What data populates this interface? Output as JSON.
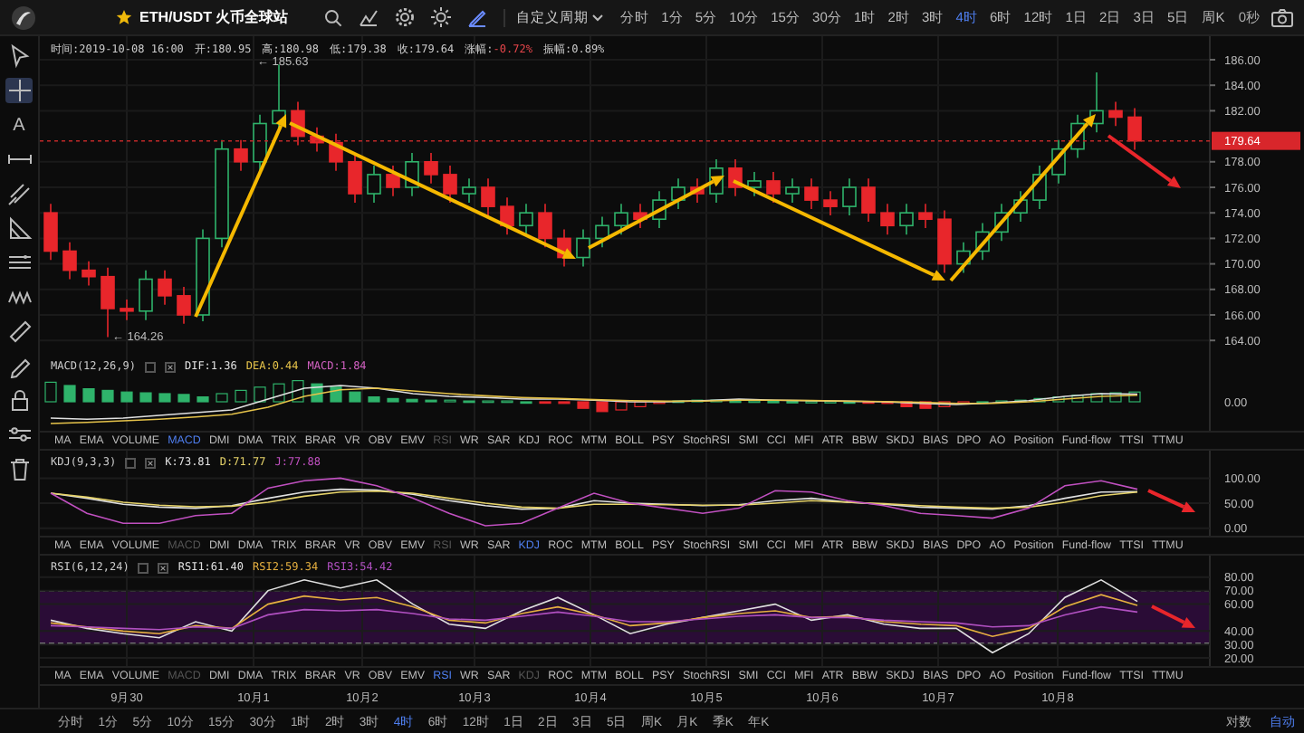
{
  "toolbar": {
    "symbol": "ETH/USDT 火币全球站",
    "custom_period": "自定义周期",
    "countdown": "0秒",
    "periods": [
      {
        "label": "分时",
        "selected": false
      },
      {
        "label": "1分",
        "selected": false
      },
      {
        "label": "5分",
        "selected": false
      },
      {
        "label": "10分",
        "selected": false
      },
      {
        "label": "15分",
        "selected": false
      },
      {
        "label": "30分",
        "selected": false
      },
      {
        "label": "1时",
        "selected": false
      },
      {
        "label": "2时",
        "selected": false
      },
      {
        "label": "3时",
        "selected": false
      },
      {
        "label": "4时",
        "selected": true
      },
      {
        "label": "6时",
        "selected": false
      },
      {
        "label": "12时",
        "selected": false
      },
      {
        "label": "1日",
        "selected": false
      },
      {
        "label": "2日",
        "selected": false
      },
      {
        "label": "3日",
        "selected": false
      },
      {
        "label": "5日",
        "selected": false
      },
      {
        "label": "周K",
        "selected": false
      }
    ]
  },
  "drawing_tools": [
    {
      "selected": false
    },
    {
      "selected": true
    },
    {
      "selected": false,
      "glyph": "A"
    },
    {
      "selected": false
    },
    {
      "selected": false
    },
    {
      "selected": false
    },
    {
      "selected": false
    },
    {
      "selected": false
    },
    {
      "selected": false
    },
    {
      "selected": false
    },
    {
      "selected": false
    },
    {
      "selected": false
    },
    {
      "selected": false
    }
  ],
  "quote": [
    {
      "label": "时间:",
      "value": "2019-10-08 16:00",
      "negative": false
    },
    {
      "label": "开:",
      "value": "180.95",
      "negative": false
    },
    {
      "label": "高:",
      "value": "180.98",
      "negative": false
    },
    {
      "label": "低:",
      "value": "179.38",
      "negative": false
    },
    {
      "label": "收:",
      "value": "179.64",
      "negative": false
    },
    {
      "label": "涨幅:",
      "value": "-0.72%",
      "negative": true
    },
    {
      "label": "振幅:",
      "value": "0.89%",
      "negative": false
    }
  ],
  "price_chart": {
    "axis": [
      "186.00",
      "184.00",
      "182.00",
      "178.00",
      "176.00",
      "174.00",
      "172.00",
      "170.00",
      "168.00",
      "166.00",
      "164.00"
    ],
    "current_price": "179.64",
    "high_marker": "← 185.63",
    "low_marker": "← 164.26"
  },
  "panes": [
    {
      "kind": "macd",
      "title": "MACD(12,26,9)",
      "legend": [
        {
          "text": "DIF:1.36",
          "color": "#e0e0e0"
        },
        {
          "text": "DEA:0.44",
          "color": "#e6c34a"
        },
        {
          "text": "MACD:1.84",
          "color": "#d060c0"
        }
      ],
      "axis": [
        "0.00"
      ],
      "tabs": [
        {
          "label": "MA",
          "selected": false,
          "disabled": false
        },
        {
          "label": "EMA",
          "selected": false,
          "disabled": false
        },
        {
          "label": "VOLUME",
          "selected": false,
          "disabled": false
        },
        {
          "label": "MACD",
          "selected": true,
          "disabled": false
        },
        {
          "label": "DMI",
          "selected": false,
          "disabled": false
        },
        {
          "label": "DMA",
          "selected": false,
          "disabled": false
        },
        {
          "label": "TRIX",
          "selected": false,
          "disabled": false
        },
        {
          "label": "BRAR",
          "selected": false,
          "disabled": false
        },
        {
          "label": "VR",
          "selected": false,
          "disabled": false
        },
        {
          "label": "OBV",
          "selected": false,
          "disabled": false
        },
        {
          "label": "EMV",
          "selected": false,
          "disabled": false
        },
        {
          "label": "RSI",
          "selected": false,
          "disabled": true
        },
        {
          "label": "WR",
          "selected": false,
          "disabled": false
        },
        {
          "label": "SAR",
          "selected": false,
          "disabled": false
        },
        {
          "label": "KDJ",
          "selected": false,
          "disabled": false
        },
        {
          "label": "ROC",
          "selected": false,
          "disabled": false
        },
        {
          "label": "MTM",
          "selected": false,
          "disabled": false
        },
        {
          "label": "BOLL",
          "selected": false,
          "disabled": false
        },
        {
          "label": "PSY",
          "selected": false,
          "disabled": false
        },
        {
          "label": "StochRSI",
          "selected": false,
          "disabled": false
        },
        {
          "label": "SMI",
          "selected": false,
          "disabled": false
        },
        {
          "label": "CCI",
          "selected": false,
          "disabled": false
        },
        {
          "label": "MFI",
          "selected": false,
          "disabled": false
        },
        {
          "label": "ATR",
          "selected": false,
          "disabled": false
        },
        {
          "label": "BBW",
          "selected": false,
          "disabled": false
        },
        {
          "label": "SKDJ",
          "selected": false,
          "disabled": false
        },
        {
          "label": "BIAS",
          "selected": false,
          "disabled": false
        },
        {
          "label": "DPO",
          "selected": false,
          "disabled": false
        },
        {
          "label": "AO",
          "selected": false,
          "disabled": false
        },
        {
          "label": "Position",
          "selected": false,
          "disabled": false
        },
        {
          "label": "Fund-flow",
          "selected": false,
          "disabled": false
        },
        {
          "label": "TTSI",
          "selected": false,
          "disabled": false
        },
        {
          "label": "TTMU",
          "selected": false,
          "disabled": false
        }
      ]
    },
    {
      "kind": "kdj",
      "title": "KDJ(9,3,3)",
      "chart_data": {
        "type": "line",
        "categories": [
          null,
          null,
          null,
          null,
          null,
          null,
          null,
          null,
          null,
          null,
          null,
          null,
          null,
          null,
          null,
          null,
          null,
          null,
          null,
          null,
          null,
          null,
          null,
          null,
          null,
          null,
          null,
          null,
          null,
          null,
          null
        ],
        "ylim": [
          -15,
          155
        ],
        "grid": true,
        "yticks": [
          {
            "value": 100,
            "label": "100.00"
          },
          {
            "value": 50,
            "label": "50.00"
          },
          {
            "value": 0,
            "label": "0.00"
          }
        ],
        "series": [
          {
            "name": "K:73.81",
            "color": "#e0e0e0",
            "values": [
              70,
              60,
              48,
              42,
              40,
              45,
              60,
              72,
              78,
              76,
              68,
              55,
              45,
              38,
              40,
              55,
              50,
              48,
              45,
              47,
              55,
              60,
              52,
              48,
              42,
              40,
              38,
              45,
              60,
              72,
              73
            ]
          },
          {
            "name": "D:71.77",
            "color": "#e6d36a",
            "values": [
              70,
              62,
              52,
              46,
              43,
              44,
              52,
              64,
              72,
              74,
              70,
              60,
              50,
              42,
              40,
              48,
              48,
              47,
              46,
              46,
              50,
              55,
              52,
              49,
              45,
              42,
              40,
              42,
              52,
              65,
              72
            ]
          },
          {
            "name": "J:77.88",
            "color": "#c050c0",
            "values": [
              70,
              30,
              10,
              10,
              25,
              30,
              80,
              95,
              100,
              85,
              60,
              30,
              5,
              10,
              40,
              70,
              50,
              40,
              30,
              40,
              75,
              72,
              55,
              45,
              30,
              25,
              20,
              40,
              85,
              95,
              78
            ]
          }
        ]
      },
      "tabs": [
        {
          "label": "MA",
          "selected": false,
          "disabled": false
        },
        {
          "label": "EMA",
          "selected": false,
          "disabled": false
        },
        {
          "label": "VOLUME",
          "selected": false,
          "disabled": false
        },
        {
          "label": "MACD",
          "selected": false,
          "disabled": true
        },
        {
          "label": "DMI",
          "selected": false,
          "disabled": false
        },
        {
          "label": "DMA",
          "selected": false,
          "disabled": false
        },
        {
          "label": "TRIX",
          "selected": false,
          "disabled": false
        },
        {
          "label": "BRAR",
          "selected": false,
          "disabled": false
        },
        {
          "label": "VR",
          "selected": false,
          "disabled": false
        },
        {
          "label": "OBV",
          "selected": false,
          "disabled": false
        },
        {
          "label": "EMV",
          "selected": false,
          "disabled": false
        },
        {
          "label": "RSI",
          "selected": false,
          "disabled": true
        },
        {
          "label": "WR",
          "selected": false,
          "disabled": false
        },
        {
          "label": "SAR",
          "selected": false,
          "disabled": false
        },
        {
          "label": "KDJ",
          "selected": true,
          "disabled": false
        },
        {
          "label": "ROC",
          "selected": false,
          "disabled": false
        },
        {
          "label": "MTM",
          "selected": false,
          "disabled": false
        },
        {
          "label": "BOLL",
          "selected": false,
          "disabled": false
        },
        {
          "label": "PSY",
          "selected": false,
          "disabled": false
        },
        {
          "label": "StochRSI",
          "selected": false,
          "disabled": false
        },
        {
          "label": "SMI",
          "selected": false,
          "disabled": false
        },
        {
          "label": "CCI",
          "selected": false,
          "disabled": false
        },
        {
          "label": "MFI",
          "selected": false,
          "disabled": false
        },
        {
          "label": "ATR",
          "selected": false,
          "disabled": false
        },
        {
          "label": "BBW",
          "selected": false,
          "disabled": false
        },
        {
          "label": "SKDJ",
          "selected": false,
          "disabled": false
        },
        {
          "label": "BIAS",
          "selected": false,
          "disabled": false
        },
        {
          "label": "DPO",
          "selected": false,
          "disabled": false
        },
        {
          "label": "AO",
          "selected": false,
          "disabled": false
        },
        {
          "label": "Position",
          "selected": false,
          "disabled": false
        },
        {
          "label": "Fund-flow",
          "selected": false,
          "disabled": false
        },
        {
          "label": "TTSI",
          "selected": false,
          "disabled": false
        },
        {
          "label": "TTMU",
          "selected": false,
          "disabled": false
        }
      ]
    },
    {
      "kind": "rsi",
      "title": "RSI(6,12,24)",
      "chart_data": {
        "type": "line",
        "categories": [
          null,
          null,
          null,
          null,
          null,
          null,
          null,
          null,
          null,
          null,
          null,
          null,
          null,
          null,
          null,
          null,
          null,
          null,
          null,
          null,
          null,
          null,
          null,
          null,
          null,
          null,
          null,
          null,
          null,
          null,
          null
        ],
        "ylim": [
          14,
          96
        ],
        "grid": true,
        "yticks": [
          {
            "value": 80,
            "label": "80.00"
          },
          {
            "value": 70,
            "label": "70.00"
          },
          {
            "value": 60,
            "label": "60.00"
          },
          {
            "value": 40,
            "label": "40.00"
          },
          {
            "value": 30,
            "label": "30.00"
          },
          {
            "value": 20,
            "label": "20.00"
          }
        ],
        "series": [
          {
            "name": "RSI1:61.40",
            "color": "#e0e0e0",
            "values": [
              48,
              42,
              38,
              35,
              47,
              40,
              70,
              78,
              72,
              78,
              60,
              45,
              42,
              55,
              65,
              52,
              38,
              45,
              50,
              55,
              60,
              48,
              52,
              45,
              42,
              42,
              24,
              38,
              65,
              78,
              62
            ]
          },
          {
            "name": "RSI2:59.34",
            "color": "#e6b040",
            "values": [
              46,
              43,
              40,
              38,
              44,
              42,
              60,
              66,
              63,
              65,
              58,
              48,
              46,
              53,
              58,
              52,
              44,
              46,
              50,
              53,
              55,
              50,
              51,
              47,
              45,
              44,
              36,
              42,
              58,
              67,
              59
            ]
          },
          {
            "name": "RSI3:54.42",
            "color": "#b050c0",
            "values": [
              44,
              43,
              42,
              41,
              43,
              42,
              52,
              56,
              55,
              56,
              53,
              49,
              48,
              51,
              54,
              51,
              47,
              47,
              49,
              51,
              52,
              50,
              50,
              48,
              47,
              46,
              43,
              44,
              52,
              58,
              54
            ]
          }
        ]
      },
      "tabs": [
        {
          "label": "MA",
          "selected": false,
          "disabled": false
        },
        {
          "label": "EMA",
          "selected": false,
          "disabled": false
        },
        {
          "label": "VOLUME",
          "selected": false,
          "disabled": false
        },
        {
          "label": "MACD",
          "selected": false,
          "disabled": true
        },
        {
          "label": "DMI",
          "selected": false,
          "disabled": false
        },
        {
          "label": "DMA",
          "selected": false,
          "disabled": false
        },
        {
          "label": "TRIX",
          "selected": false,
          "disabled": false
        },
        {
          "label": "BRAR",
          "selected": false,
          "disabled": false
        },
        {
          "label": "VR",
          "selected": false,
          "disabled": false
        },
        {
          "label": "OBV",
          "selected": false,
          "disabled": false
        },
        {
          "label": "EMV",
          "selected": false,
          "disabled": false
        },
        {
          "label": "RSI",
          "selected": true,
          "disabled": false
        },
        {
          "label": "WR",
          "selected": false,
          "disabled": false
        },
        {
          "label": "SAR",
          "selected": false,
          "disabled": false
        },
        {
          "label": "KDJ",
          "selected": false,
          "disabled": true
        },
        {
          "label": "ROC",
          "selected": false,
          "disabled": false
        },
        {
          "label": "MTM",
          "selected": false,
          "disabled": false
        },
        {
          "label": "BOLL",
          "selected": false,
          "disabled": false
        },
        {
          "label": "PSY",
          "selected": false,
          "disabled": false
        },
        {
          "label": "StochRSI",
          "selected": false,
          "disabled": false
        },
        {
          "label": "SMI",
          "selected": false,
          "disabled": false
        },
        {
          "label": "CCI",
          "selected": false,
          "disabled": false
        },
        {
          "label": "MFI",
          "selected": false,
          "disabled": false
        },
        {
          "label": "ATR",
          "selected": false,
          "disabled": false
        },
        {
          "label": "BBW",
          "selected": false,
          "disabled": false
        },
        {
          "label": "SKDJ",
          "selected": false,
          "disabled": false
        },
        {
          "label": "BIAS",
          "selected": false,
          "disabled": false
        },
        {
          "label": "DPO",
          "selected": false,
          "disabled": false
        },
        {
          "label": "AO",
          "selected": false,
          "disabled": false
        },
        {
          "label": "Position",
          "selected": false,
          "disabled": false
        },
        {
          "label": "Fund-flow",
          "selected": false,
          "disabled": false
        },
        {
          "label": "TTSI",
          "selected": false,
          "disabled": false
        },
        {
          "label": "TTMU",
          "selected": false,
          "disabled": false
        }
      ]
    }
  ],
  "date_axis": [
    "9月30",
    "10月1",
    "10月2",
    "10月3",
    "10月4",
    "10月5",
    "10月6",
    "10月7",
    "10月8"
  ],
  "bottom_bar": {
    "periods": [
      {
        "label": "分时",
        "selected": false
      },
      {
        "label": "1分",
        "selected": false
      },
      {
        "label": "5分",
        "selected": false
      },
      {
        "label": "10分",
        "selected": false
      },
      {
        "label": "15分",
        "selected": false
      },
      {
        "label": "30分",
        "selected": false
      },
      {
        "label": "1时",
        "selected": false
      },
      {
        "label": "2时",
        "selected": false
      },
      {
        "label": "3时",
        "selected": false
      },
      {
        "label": "4时",
        "selected": true
      },
      {
        "label": "6时",
        "selected": false
      },
      {
        "label": "12时",
        "selected": false
      },
      {
        "label": "1日",
        "selected": false
      },
      {
        "label": "2日",
        "selected": false
      },
      {
        "label": "3日",
        "selected": false
      },
      {
        "label": "5日",
        "selected": false
      },
      {
        "label": "周K",
        "selected": false
      },
      {
        "label": "月K",
        "selected": false
      },
      {
        "label": "季K",
        "selected": false
      },
      {
        "label": "年K",
        "selected": false
      }
    ],
    "scale_options": [
      {
        "label": "对数",
        "selected": false
      },
      {
        "label": "自动",
        "selected": true
      }
    ]
  }
}
